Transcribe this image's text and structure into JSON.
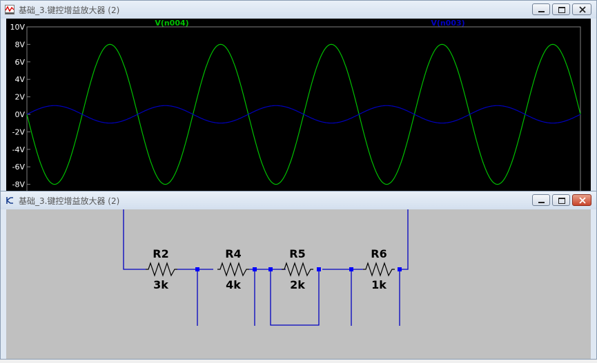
{
  "waveform_window": {
    "title": "基础_3.键控增益放大器 (2)",
    "traces": [
      {
        "name": "V(n004)",
        "color": "#00c000",
        "amplitude_v": 8,
        "phase": "inverted"
      },
      {
        "name": "V(n003)",
        "color": "#0000c0",
        "amplitude_v": 1,
        "phase": "normal"
      }
    ],
    "y_axis": {
      "ticks": [
        "10V",
        "8V",
        "6V",
        "4V",
        "2V",
        "0V",
        "-2V",
        "-4V",
        "-6V",
        "-8V"
      ],
      "values": [
        10,
        8,
        6,
        4,
        2,
        0,
        -2,
        -4,
        -6,
        -8
      ]
    },
    "visible_cycles": 5,
    "background": "#000000"
  },
  "schematic_window": {
    "title": "基础_3.键控增益放大器 (2)",
    "components": [
      {
        "ref": "R2",
        "value": "3k"
      },
      {
        "ref": "R4",
        "value": "4k"
      },
      {
        "ref": "R5",
        "value": "2k"
      },
      {
        "ref": "R6",
        "value": "1k"
      }
    ],
    "wire_color": "#0000c0",
    "node_color": "#0000ff",
    "background": "#c0c0c0"
  },
  "window_controls": {
    "minimize": "minimize-icon",
    "maximize": "maximize-icon",
    "close": "close-icon"
  }
}
